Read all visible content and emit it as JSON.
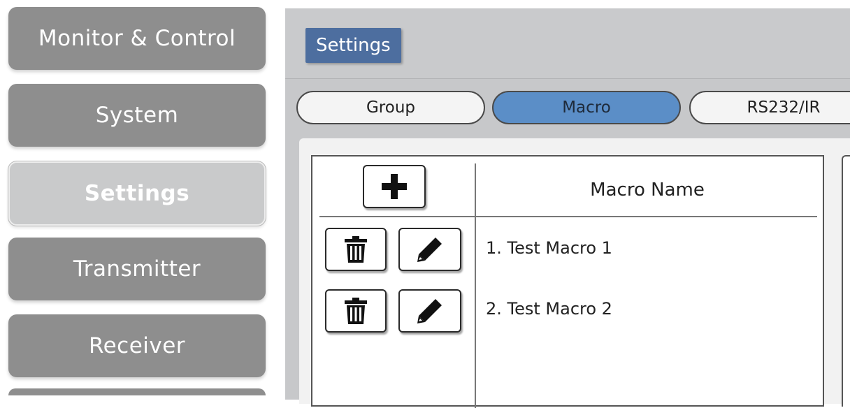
{
  "sidebar": {
    "items": [
      {
        "label": "Monitor & Control"
      },
      {
        "label": "System"
      },
      {
        "label": "Settings",
        "active": true
      },
      {
        "label": "Transmitter"
      },
      {
        "label": "Receiver"
      }
    ]
  },
  "header": {
    "title": "Settings"
  },
  "tabs": [
    {
      "label": "Group"
    },
    {
      "label": "Macro",
      "selected": true
    },
    {
      "label": "RS232/IR"
    }
  ],
  "macro_table": {
    "add_icon": "plus-icon",
    "column_header": "Macro Name",
    "rows": [
      {
        "name": "1. Test Macro 1",
        "delete_icon": "trash-icon",
        "edit_icon": "pencil-icon"
      },
      {
        "name": "2. Test Macro 2",
        "delete_icon": "trash-icon",
        "edit_icon": "pencil-icon"
      }
    ]
  },
  "colors": {
    "sidebar_button": "#8e8e8e",
    "sidebar_active": "#c9cacb",
    "title_badge": "#4d6e9f",
    "tab_selected": "#5b8ec7",
    "panel_background": "#c7c8ca"
  }
}
